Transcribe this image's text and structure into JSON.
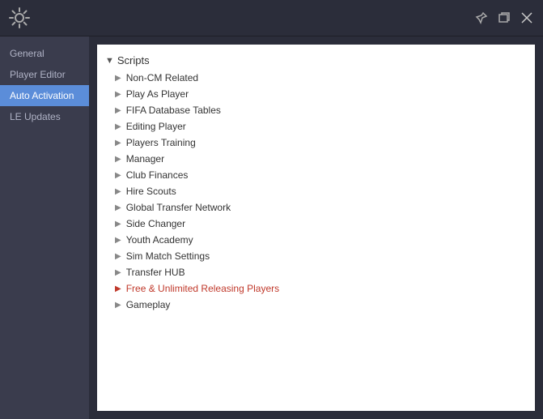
{
  "titlebar": {
    "icon": "⚙",
    "controls": {
      "pin": "📌",
      "minimize": "🗖",
      "close": "✕"
    }
  },
  "sidebar": {
    "items": [
      {
        "id": "general",
        "label": "General",
        "active": false
      },
      {
        "id": "player-editor",
        "label": "Player Editor",
        "active": false
      },
      {
        "id": "auto-activation",
        "label": "Auto Activation",
        "active": true
      },
      {
        "id": "le-updates",
        "label": "LE Updates",
        "active": false
      }
    ]
  },
  "scripts": {
    "header": "Scripts",
    "items": [
      {
        "id": "non-cm-related",
        "label": "Non-CM Related",
        "special": false
      },
      {
        "id": "play-as-player",
        "label": "Play As Player",
        "special": false
      },
      {
        "id": "fifa-database-tables",
        "label": "FIFA Database Tables",
        "special": false
      },
      {
        "id": "editing-player",
        "label": "Editing Player",
        "special": false
      },
      {
        "id": "players-training",
        "label": "Players Training",
        "special": false
      },
      {
        "id": "manager",
        "label": "Manager",
        "special": false
      },
      {
        "id": "club-finances",
        "label": "Club Finances",
        "special": false
      },
      {
        "id": "hire-scouts",
        "label": "Hire Scouts",
        "special": false
      },
      {
        "id": "global-transfer-network",
        "label": "Global Transfer Network",
        "special": false
      },
      {
        "id": "side-changer",
        "label": "Side Changer",
        "special": false
      },
      {
        "id": "youth-academy",
        "label": "Youth Academy",
        "special": false
      },
      {
        "id": "sim-match-settings",
        "label": "Sim Match Settings",
        "special": false
      },
      {
        "id": "transfer-hub",
        "label": "Transfer HUB",
        "special": false
      },
      {
        "id": "free-unlimited-releasing-players",
        "label": "Free & Unlimited Releasing Players",
        "special": true
      },
      {
        "id": "gameplay",
        "label": "Gameplay",
        "special": false
      }
    ]
  }
}
